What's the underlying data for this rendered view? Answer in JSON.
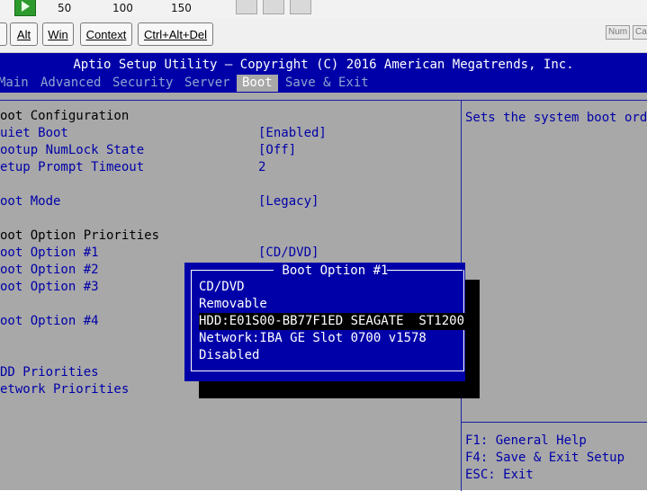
{
  "toolbar": {
    "ticks": [
      "50",
      "100",
      "150"
    ],
    "keys": [
      "Alt",
      "Win",
      "Context",
      "Ctrl+Alt+Del"
    ],
    "indicators": [
      "Num",
      "Ca"
    ]
  },
  "bios": {
    "title": "Aptio Setup Utility – Copyright (C) 2016 American Megatrends, Inc.",
    "tabs": [
      "Main",
      "Advanced",
      "Security",
      "Server",
      "Boot",
      "Save & Exit"
    ],
    "active_tab": "Boot",
    "rows": {
      "boot_configuration": "oot Configuration",
      "quiet_boot": "uiet Boot",
      "numlock": "ootup NumLock State",
      "prompt_timeout": "etup Prompt Timeout",
      "boot_mode": "oot Mode",
      "boot_option_priorities": "oot Option Priorities",
      "boot_option_1": "oot Option #1",
      "boot_option_2": "oot Option #2",
      "boot_option_3": "oot Option #3",
      "boot_option_4": "oot Option #4",
      "hdd_priorities": "DD Priorities",
      "network_priorities": "etwork Priorities"
    },
    "values": {
      "quiet_boot": "[Enabled]",
      "numlock": "[Off]",
      "prompt_timeout": "2",
      "boot_mode": "[Legacy]",
      "boot_option_1": "[CD/DVD]"
    },
    "help_text": "Sets the system boot order",
    "key_help": [
      "F1: General Help",
      "F4: Save & Exit Setup",
      "ESC: Exit"
    ],
    "popup": {
      "title": " Boot Option #1 ",
      "options": [
        "CD/DVD",
        "Removable",
        "HDD:E01S00-BB77F1ED SEAGATE  ST1200",
        "Network:IBA GE Slot 0700 v1578",
        "Disabled"
      ],
      "selected_index": 2
    }
  }
}
